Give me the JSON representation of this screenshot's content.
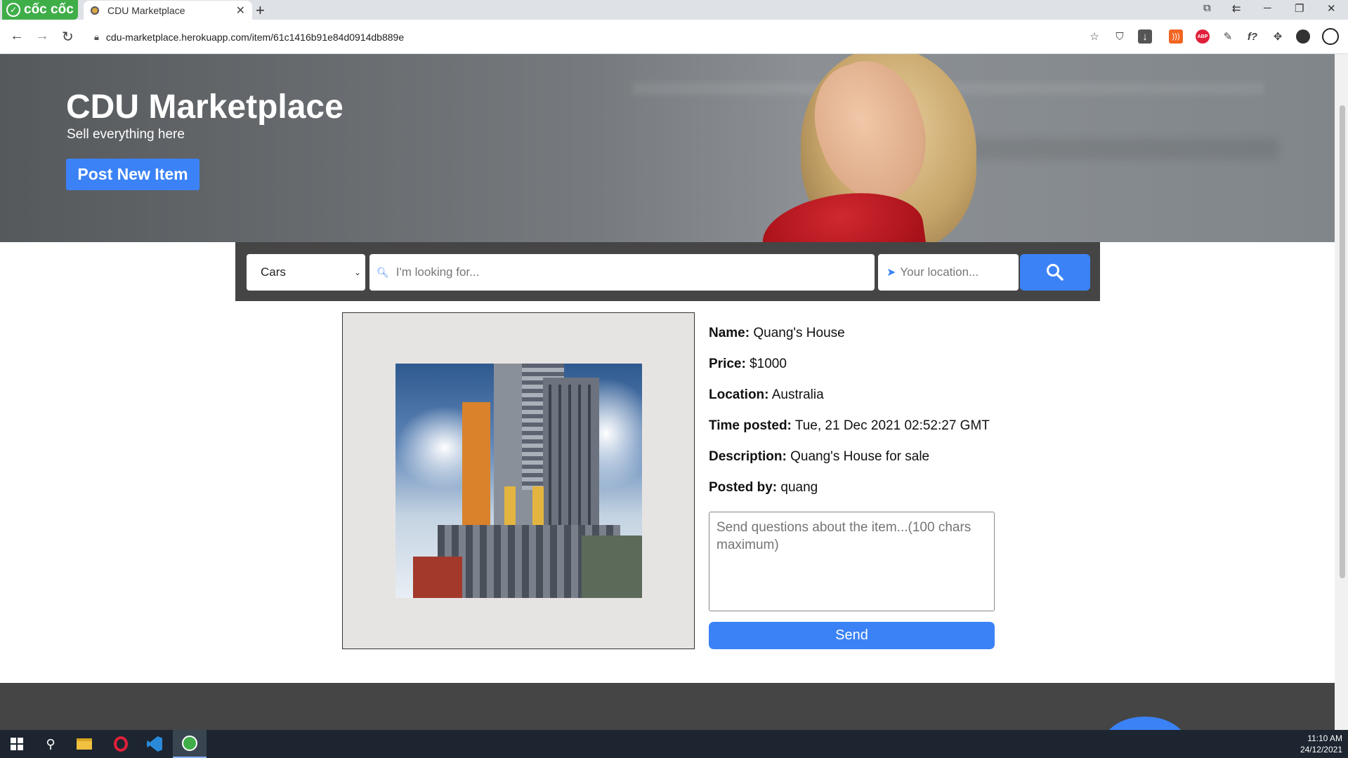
{
  "browser": {
    "brand_label": "cốc cốc",
    "tab_title": "CDU Marketplace",
    "new_tab_symbol": "+",
    "close_symbol": "✕",
    "url": "cdu-marketplace.herokuapp.com/item/61c1416b91e84d0914db889e"
  },
  "hero": {
    "title": "CDU Marketplace",
    "subtitle": "Sell everything here",
    "post_button_label": "Post New Item"
  },
  "search": {
    "category_selected": "Cars",
    "query_placeholder": "I'm looking for...",
    "location_placeholder": "Your location..."
  },
  "item": {
    "name_label": "Name:",
    "name_value": "Quang's House",
    "price_label": "Price:",
    "price_value": "$1000",
    "location_label": "Location:",
    "location_value": "Australia",
    "time_label": "Time posted:",
    "time_value": "Tue, 21 Dec 2021 02:52:27 GMT",
    "description_label": "Description:",
    "description_value": "Quang's House for sale",
    "posted_by_label": "Posted by:",
    "posted_by_value": "quang"
  },
  "question": {
    "placeholder": "Send questions about the item...(100 chars maximum)",
    "send_label": "Send"
  },
  "taskbar": {
    "time": "11:10 AM",
    "date": "24/12/2021"
  },
  "colors": {
    "accent": "#3b82f6",
    "dark_bar": "#454545",
    "brand_green": "#3fae49"
  }
}
